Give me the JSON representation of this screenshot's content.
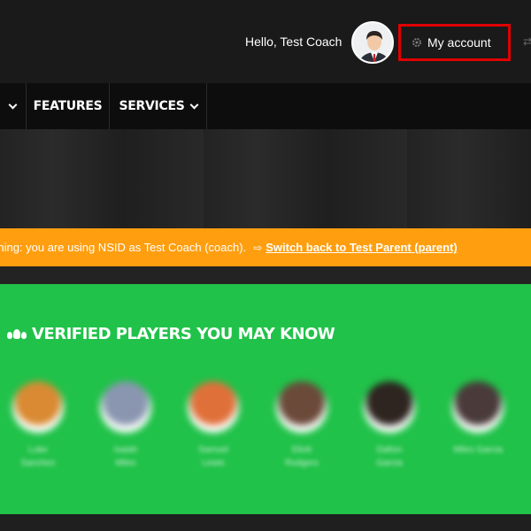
{
  "header": {
    "greeting": "Hello, Test Coach",
    "account_label": "My account",
    "edge_glyph": "⇄"
  },
  "nav": {
    "items": [
      {
        "label": "FEATURES"
      },
      {
        "label": "SERVICES"
      }
    ]
  },
  "warning": {
    "text": "Warning: you are using NSID as Test Coach (coach).",
    "switch_icon": "⇨",
    "switch_label": "Switch back to Test Parent (parent)"
  },
  "players_section": {
    "title": "VERIFIED PLAYERS YOU MAY KNOW",
    "players": [
      {
        "line1": "Luke",
        "line2": "Sanchez",
        "color": "#d98a32"
      },
      {
        "line1": "Isaiah",
        "line2": "Miles",
        "color": "#8a96b0"
      },
      {
        "line1": "Samuel",
        "line2": "Lewis",
        "color": "#e0703a"
      },
      {
        "line1": "Eliott",
        "line2": "Rodgers",
        "color": "#6b4a3a"
      },
      {
        "line1": "Dalton",
        "line2": "Garcia",
        "color": "#2e2420"
      },
      {
        "line1": "Miles Garcia",
        "line2": "",
        "color": "#4a3a3a"
      }
    ]
  },
  "colors": {
    "warning_bg": "#ff9e0f",
    "section_bg": "#21c24a",
    "highlight": "#e00000"
  }
}
